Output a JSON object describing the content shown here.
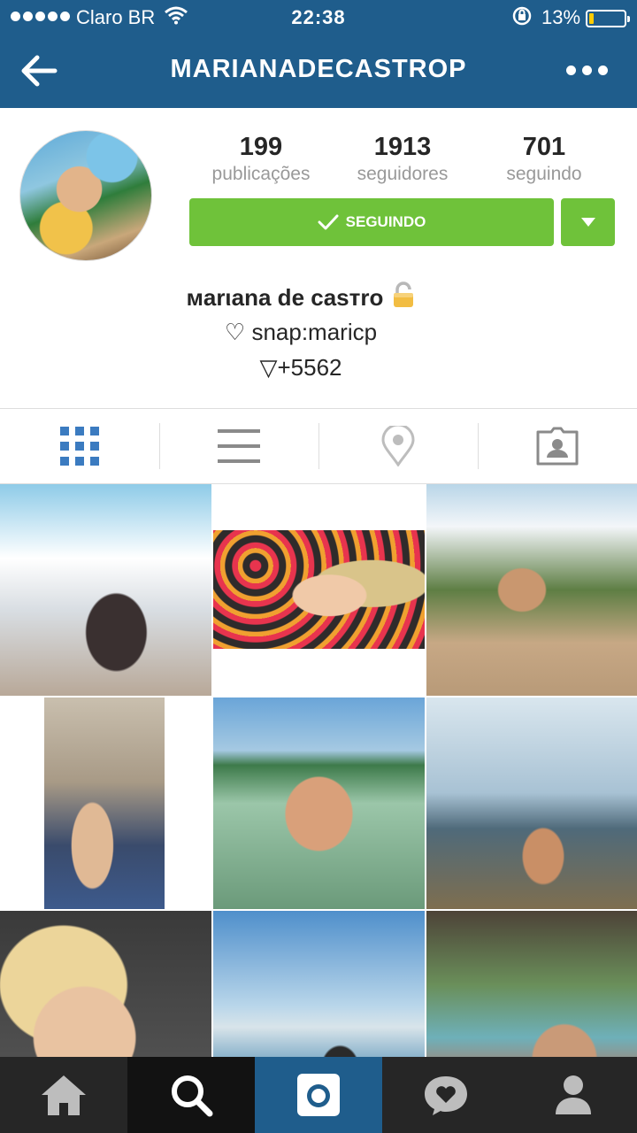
{
  "status_bar": {
    "carrier": "Claro BR",
    "time": "22:38",
    "battery_pct": "13%",
    "battery_level": 0.13
  },
  "header": {
    "title": "MARIANADECASTROP"
  },
  "profile": {
    "stats": [
      {
        "value": "199",
        "label": "publicações"
      },
      {
        "value": "1913",
        "label": "seguidores"
      },
      {
        "value": "701",
        "label": "seguindo"
      }
    ],
    "follow_label": "SEGUINDO",
    "bio_name": "мarιana de caѕтro",
    "bio_lines": [
      "♡ snap:maricp",
      "▽+5562"
    ]
  },
  "colors": {
    "header_bg": "#1f5d8c",
    "follow_green": "#6fc23a",
    "active_tab": "#3b7bc0"
  },
  "icons": {
    "tabs": [
      "grid-icon",
      "list-icon",
      "location-pin-icon",
      "tagged-photos-icon"
    ],
    "nav": [
      "home-icon",
      "search-icon",
      "camera-icon",
      "activity-heart-icon",
      "profile-icon"
    ]
  }
}
